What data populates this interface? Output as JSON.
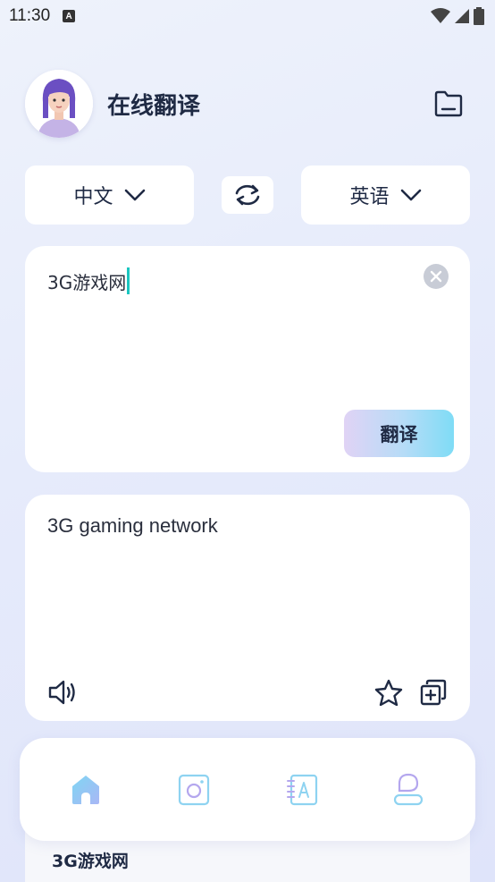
{
  "status_bar": {
    "time": "11:30",
    "notification_icon_letter": "A",
    "icons": [
      "wifi-icon",
      "signal-icon",
      "battery-icon"
    ]
  },
  "header": {
    "title": "在线翻译",
    "avatar_icon": "avatar-icon",
    "folder_icon": "folder-icon"
  },
  "languages": {
    "source": "中文",
    "target": "英语",
    "swap_icon": "swap-icon",
    "dropdown_icon": "chevron-down-icon"
  },
  "input": {
    "text": "3G游戏网",
    "clear_icon": "clear-icon",
    "translate_label": "翻译"
  },
  "output": {
    "text": "3G gaming network",
    "icons": [
      "speaker-icon",
      "star-icon",
      "copy-icon"
    ]
  },
  "bottom_nav": {
    "items": [
      {
        "name": "home",
        "icon": "home-icon",
        "active": true
      },
      {
        "name": "camera",
        "icon": "camera-icon",
        "active": false
      },
      {
        "name": "dictionary",
        "icon": "dictionary-icon",
        "active": false
      },
      {
        "name": "profile",
        "icon": "user-icon",
        "active": false
      }
    ]
  },
  "history_preview": {
    "text": "3G游戏网"
  },
  "colors": {
    "accent_teal": "#1bc6c0",
    "text_dark": "#1f2a44",
    "nav_icon": "#7fd0f0",
    "button_gradient_start": "#e0d3f5",
    "button_gradient_end": "#7fdcf6"
  }
}
